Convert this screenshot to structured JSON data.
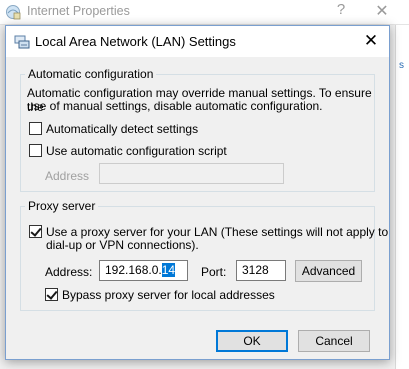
{
  "background_window": {
    "title": "Internet Properties",
    "help_glyph": "?",
    "close_glyph": "✕",
    "right_link_fragment": "s"
  },
  "dialog": {
    "title": "Local Area Network (LAN) Settings",
    "close_glyph": "✕",
    "auto_config": {
      "legend": "Automatic configuration",
      "description_line1": "Automatic configuration may override manual settings.  To ensure the",
      "description_line2": "use of manual settings, disable automatic configuration.",
      "auto_detect_label": "Automatically detect settings",
      "auto_detect_checked": false,
      "use_script_label": "Use automatic configuration script",
      "use_script_checked": false,
      "address_label": "Address",
      "address_value": ""
    },
    "proxy": {
      "legend": "Proxy server",
      "use_proxy_label_line1": "Use a proxy server for your LAN (These settings will not apply to",
      "use_proxy_label_line2": "dial-up or VPN connections).",
      "use_proxy_checked": true,
      "address_label": "Address:",
      "address_value_prefix": "192.168.0.",
      "address_value_selected": "14",
      "port_label": "Port:",
      "port_value": "3128",
      "advanced_label": "Advanced",
      "bypass_label": "Bypass proxy server for local addresses",
      "bypass_checked": true
    },
    "ok_label": "OK",
    "cancel_label": "Cancel"
  },
  "colors": {
    "selection": "#0078d7",
    "dialog_border": "#7a9fcf",
    "face": "#f0f0f0"
  }
}
